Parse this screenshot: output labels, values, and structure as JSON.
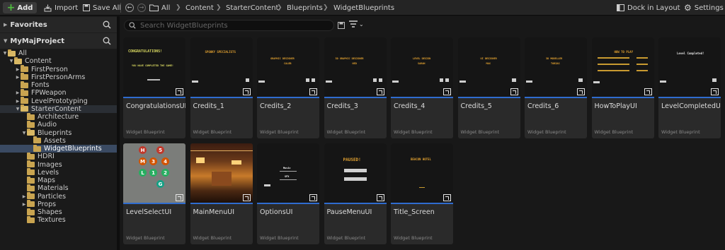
{
  "toolbar": {
    "add_label": "Add",
    "import_label": "Import",
    "save_all_label": "Save All",
    "dock_label": "Dock in Layout",
    "settings_label": "Settings"
  },
  "breadcrumb": [
    "All",
    "Content",
    "StarterContent",
    "Blueprints",
    "WidgetBlueprints"
  ],
  "left_panel": {
    "favorites_label": "Favorites",
    "project_label": "MyMajProject",
    "tree": [
      {
        "label": "All",
        "depth": 0,
        "arrow": "down",
        "open": true
      },
      {
        "label": "Content",
        "depth": 1,
        "arrow": "down",
        "open": true
      },
      {
        "label": "FirstPerson",
        "depth": 2,
        "arrow": "right"
      },
      {
        "label": "FirstPersonArms",
        "depth": 2,
        "arrow": "right"
      },
      {
        "label": "Fonts",
        "depth": 2,
        "arrow": ""
      },
      {
        "label": "FPWeapon",
        "depth": 2,
        "arrow": "right"
      },
      {
        "label": "LevelPrototyping",
        "depth": 2,
        "arrow": "right"
      },
      {
        "label": "StarterContent",
        "depth": 2,
        "arrow": "down",
        "open": true,
        "hl": true
      },
      {
        "label": "Architecture",
        "depth": 3,
        "arrow": ""
      },
      {
        "label": "Audio",
        "depth": 3,
        "arrow": ""
      },
      {
        "label": "Blueprints",
        "depth": 3,
        "arrow": "down",
        "open": true
      },
      {
        "label": "Assets",
        "depth": 4,
        "arrow": ""
      },
      {
        "label": "WidgetBlueprints",
        "depth": 4,
        "arrow": "",
        "selected": true
      },
      {
        "label": "HDRI",
        "depth": 3,
        "arrow": ""
      },
      {
        "label": "Images",
        "depth": 3,
        "arrow": ""
      },
      {
        "label": "Levels",
        "depth": 3,
        "arrow": ""
      },
      {
        "label": "Maps",
        "depth": 3,
        "arrow": ""
      },
      {
        "label": "Materials",
        "depth": 3,
        "arrow": ""
      },
      {
        "label": "Particles",
        "depth": 3,
        "arrow": "right"
      },
      {
        "label": "Props",
        "depth": 3,
        "arrow": "right"
      },
      {
        "label": "Shapes",
        "depth": 3,
        "arrow": ""
      },
      {
        "label": "Textures",
        "depth": 3,
        "arrow": ""
      }
    ]
  },
  "search": {
    "placeholder": "Search WidgetBlueprints"
  },
  "assets": [
    {
      "name": "CongratulationsUI",
      "type": "Widget Blueprint"
    },
    {
      "name": "Credits_1",
      "type": "Widget Blueprint"
    },
    {
      "name": "Credits_2",
      "type": "Widget Blueprint"
    },
    {
      "name": "Credits_3",
      "type": "Widget Blueprint"
    },
    {
      "name": "Credits_4",
      "type": "Widget Blueprint"
    },
    {
      "name": "Credits_5",
      "type": "Widget Blueprint"
    },
    {
      "name": "Credits_6",
      "type": "Widget Blueprint"
    },
    {
      "name": "HowToPlayUI",
      "type": "Widget Blueprint"
    },
    {
      "name": "LevelCompletedUI",
      "type": "Widget Blueprint"
    },
    {
      "name": "LevelSelectUI",
      "type": "Widget Blueprint"
    },
    {
      "name": "MainMenuUI",
      "type": "Widget Blueprint"
    },
    {
      "name": "OptionsUI",
      "type": "Widget Blueprint"
    },
    {
      "name": "PauseMenuUI",
      "type": "Widget Blueprint"
    },
    {
      "name": "Title_Screen",
      "type": "Widget Blueprint"
    }
  ],
  "thumbs": {
    "congrats_title": "CONGRATULATIONS!",
    "congrats_sub": "YOU HAVE COMPLETED THE GAME!",
    "credits1_title": "SPOOKY SPECIALISTS",
    "credits2_title": "GRAPHIC DESIGNER",
    "credits2_sub": "CALEB",
    "credits3_title": "3D GRAPHIC DESIGNER",
    "credits3_sub": "NED",
    "credits4_title": "LEVEL DESIGN",
    "credits4_sub": "SARAH",
    "credits5_title": "UI DESIGNER",
    "credits5_sub": "MAX",
    "credits6_title": "3D MODELLER",
    "credits6_sub": "TOBIAS",
    "howto_title": "HOW TO PLAY",
    "level_completed": "Level Completed!",
    "level_letters": [
      "H",
      "5",
      "M",
      "3",
      "4",
      "L",
      "1",
      "2",
      "G"
    ],
    "options_a": "Music",
    "options_b": "SFX",
    "paused": "PAUSED!",
    "title_screen": "BEACON HOTEL"
  }
}
